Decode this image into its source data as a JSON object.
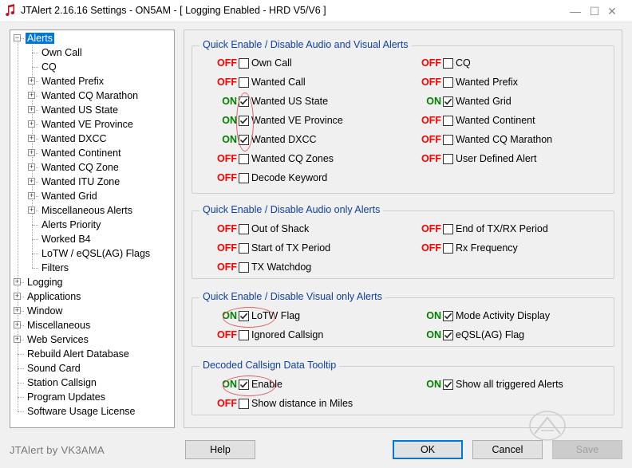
{
  "window": {
    "title": "JTAlert 2.16.16 Settings  -  ON5AM  -  [ Logging Enabled - HRD V5/V6 ]",
    "minimize_glyph": "—",
    "maximize_glyph": "☐",
    "close_glyph": "✕"
  },
  "tree": {
    "items": [
      {
        "label": "Alerts",
        "level": 0,
        "expander": "minus",
        "selected": true
      },
      {
        "label": "Own Call",
        "level": 1,
        "expander": "none"
      },
      {
        "label": "CQ",
        "level": 1,
        "expander": "none"
      },
      {
        "label": "Wanted Prefix",
        "level": 1,
        "expander": "plus"
      },
      {
        "label": "Wanted CQ Marathon",
        "level": 1,
        "expander": "plus"
      },
      {
        "label": "Wanted US State",
        "level": 1,
        "expander": "plus"
      },
      {
        "label": "Wanted VE Province",
        "level": 1,
        "expander": "plus"
      },
      {
        "label": "Wanted DXCC",
        "level": 1,
        "expander": "plus"
      },
      {
        "label": "Wanted Continent",
        "level": 1,
        "expander": "plus"
      },
      {
        "label": "Wanted CQ Zone",
        "level": 1,
        "expander": "plus"
      },
      {
        "label": "Wanted ITU Zone",
        "level": 1,
        "expander": "plus"
      },
      {
        "label": "Wanted Grid",
        "level": 1,
        "expander": "plus"
      },
      {
        "label": "Miscellaneous Alerts",
        "level": 1,
        "expander": "plus"
      },
      {
        "label": "Alerts Priority",
        "level": 1,
        "expander": "none"
      },
      {
        "label": "Worked B4",
        "level": 1,
        "expander": "none"
      },
      {
        "label": "LoTW / eQSL(AG) Flags",
        "level": 1,
        "expander": "none"
      },
      {
        "label": "Filters",
        "level": 1,
        "expander": "none"
      },
      {
        "label": "Logging",
        "level": 0,
        "expander": "plus"
      },
      {
        "label": "Applications",
        "level": 0,
        "expander": "plus"
      },
      {
        "label": "Window",
        "level": 0,
        "expander": "plus"
      },
      {
        "label": "Miscellaneous",
        "level": 0,
        "expander": "plus"
      },
      {
        "label": "Web Services",
        "level": 0,
        "expander": "plus"
      },
      {
        "label": "Rebuild Alert Database",
        "level": 0,
        "expander": "none"
      },
      {
        "label": "Sound Card",
        "level": 0,
        "expander": "none"
      },
      {
        "label": "Station Callsign",
        "level": 0,
        "expander": "none"
      },
      {
        "label": "Program Updates",
        "level": 0,
        "expander": "none"
      },
      {
        "label": "Software Usage License",
        "level": 0,
        "expander": "none"
      }
    ]
  },
  "groups": [
    {
      "title": "Quick Enable / Disable Audio and Visual Alerts",
      "options": [
        {
          "state": "OFF",
          "checked": false,
          "label": "Own Call",
          "col": 0,
          "row": 0
        },
        {
          "state": "OFF",
          "checked": false,
          "label": "Wanted Call",
          "col": 0,
          "row": 1
        },
        {
          "state": "ON",
          "checked": true,
          "label": "Wanted US State",
          "col": 0,
          "row": 2
        },
        {
          "state": "ON",
          "checked": true,
          "label": "Wanted VE Province",
          "col": 0,
          "row": 3
        },
        {
          "state": "ON",
          "checked": true,
          "label": "Wanted DXCC",
          "col": 0,
          "row": 4
        },
        {
          "state": "OFF",
          "checked": false,
          "label": "Wanted CQ Zones",
          "col": 0,
          "row": 5
        },
        {
          "state": "OFF",
          "checked": false,
          "label": "Decode Keyword",
          "col": 0,
          "row": 6
        },
        {
          "state": "OFF",
          "checked": false,
          "label": "CQ",
          "col": 1,
          "row": 0
        },
        {
          "state": "OFF",
          "checked": false,
          "label": "Wanted Prefix",
          "col": 1,
          "row": 1
        },
        {
          "state": "ON",
          "checked": true,
          "label": "Wanted Grid",
          "col": 1,
          "row": 2
        },
        {
          "state": "OFF",
          "checked": false,
          "label": "Wanted Continent",
          "col": 1,
          "row": 3
        },
        {
          "state": "OFF",
          "checked": false,
          "label": "Wanted CQ Marathon",
          "col": 1,
          "row": 4
        },
        {
          "state": "OFF",
          "checked": false,
          "label": "User Defined Alert",
          "col": 1,
          "row": 5
        }
      ]
    },
    {
      "title": "Quick Enable / Disable Audio only Alerts",
      "options": [
        {
          "state": "OFF",
          "checked": false,
          "label": "Out of Shack",
          "col": 0,
          "row": 0
        },
        {
          "state": "OFF",
          "checked": false,
          "label": "Start of TX Period",
          "col": 0,
          "row": 1
        },
        {
          "state": "OFF",
          "checked": false,
          "label": "TX Watchdog",
          "col": 0,
          "row": 2
        },
        {
          "state": "OFF",
          "checked": false,
          "label": "End of TX/RX Period",
          "col": 1,
          "row": 0
        },
        {
          "state": "OFF",
          "checked": false,
          "label": "Rx Frequency",
          "col": 1,
          "row": 1
        }
      ]
    },
    {
      "title": "Quick Enable / Disable Visual only Alerts",
      "options": [
        {
          "state": "ON",
          "checked": true,
          "label": "LoTW Flag",
          "col": 0,
          "row": 0
        },
        {
          "state": "OFF",
          "checked": false,
          "label": "Ignored Callsign",
          "col": 0,
          "row": 1
        },
        {
          "state": "ON",
          "checked": true,
          "label": "Mode Activity Display",
          "col": 1,
          "row": 0
        },
        {
          "state": "ON",
          "checked": true,
          "label": "eQSL(AG) Flag",
          "col": 1,
          "row": 1
        }
      ]
    },
    {
      "title": "Decoded Callsign Data Tooltip",
      "options": [
        {
          "state": "ON",
          "checked": true,
          "label": "Enable",
          "col": 0,
          "row": 0
        },
        {
          "state": "OFF",
          "checked": false,
          "label": "Show distance in Miles",
          "col": 0,
          "row": 1
        },
        {
          "state": "ON",
          "checked": true,
          "label": "Show all triggered Alerts",
          "col": 1,
          "row": 0
        }
      ]
    }
  ],
  "footer": {
    "brand": "JTAlert by VK3AMA",
    "help_label": "Help",
    "ok_label": "OK",
    "cancel_label": "Cancel",
    "save_label": "Save"
  },
  "colors": {
    "off": "#ff0000",
    "on": "#008000",
    "group_title": "#0f3f9e",
    "selection": "#0078d7"
  }
}
